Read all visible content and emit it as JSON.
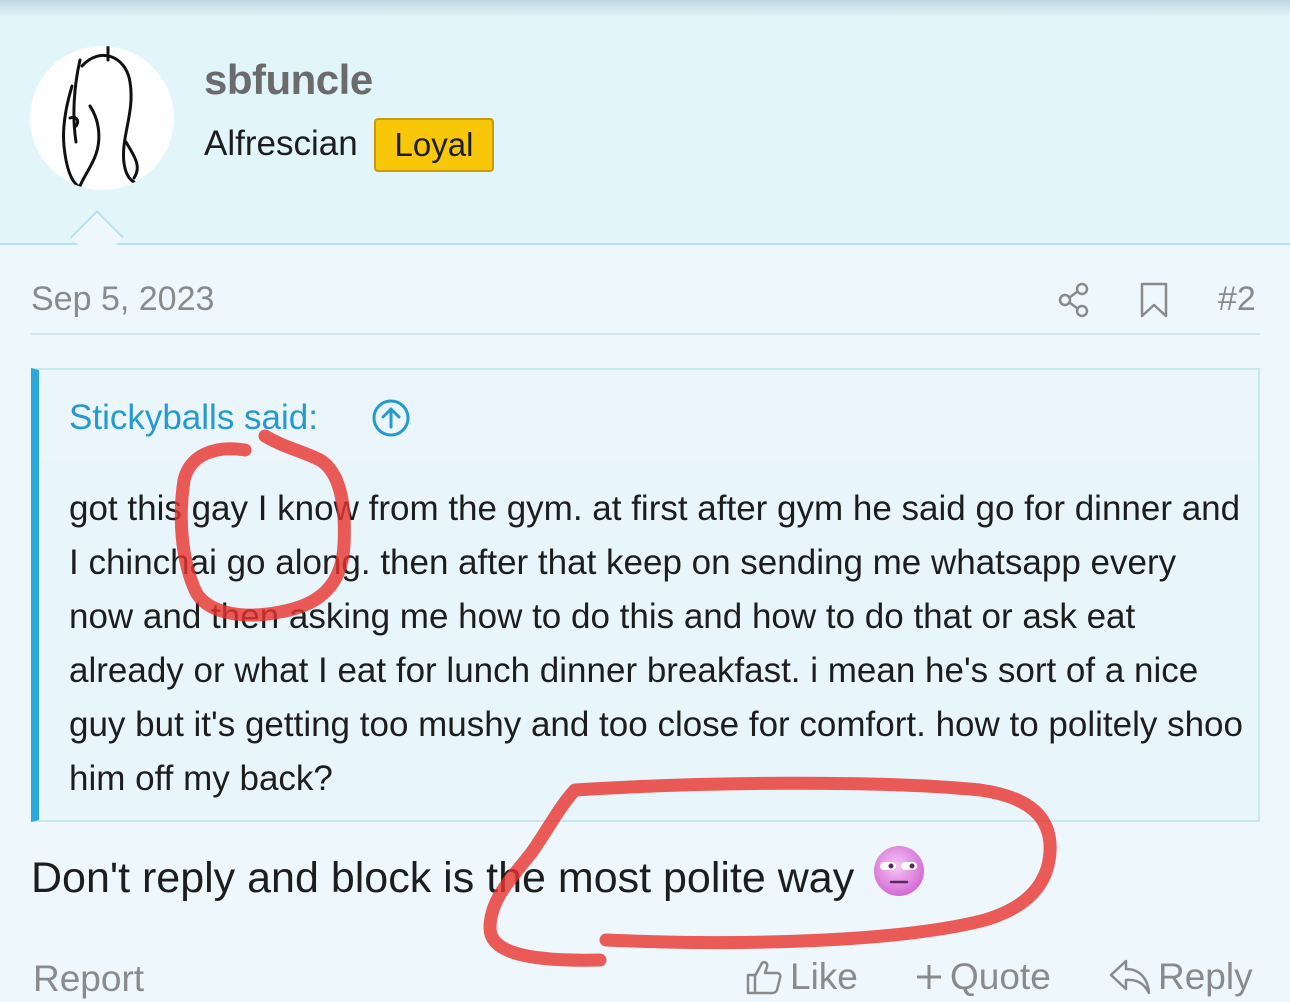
{
  "user": {
    "username": "sbfuncle",
    "title": "Alfrescian",
    "badge": "Loyal"
  },
  "post": {
    "date": "Sep 5, 2023",
    "number": "#2"
  },
  "quote": {
    "attribution": "Stickyballs said:",
    "text": "got this gay I know from the gym. at first after gym he said go for dinner and I chinchai go along. then after that keep on sending me whatsapp every now and then asking me how to do this and how to do that or ask eat already or what I eat for lunch dinner breakfast. i mean he's sort of a nice guy but it's getting too mushy and too close for comfort. how to politely shoo him off my back?"
  },
  "reply": {
    "text": "Don't reply and block is the most polite way"
  },
  "actions": {
    "report": "Report",
    "like": "Like",
    "quote": "Quote",
    "reply": "Reply"
  },
  "icons": {
    "share": "share-icon",
    "bookmark": "bookmark-icon",
    "quote_jump": "arrow-up-circle-icon",
    "emoji": "disappointed-face-emoji-icon",
    "like": "thumbs-up-icon",
    "quote": "plus-icon",
    "reply": "reply-arrow-icon"
  },
  "colors": {
    "accent": "#2699d1",
    "badge": "#f8c70a",
    "annotation": "#e8332e",
    "background": "#eef8fc"
  }
}
